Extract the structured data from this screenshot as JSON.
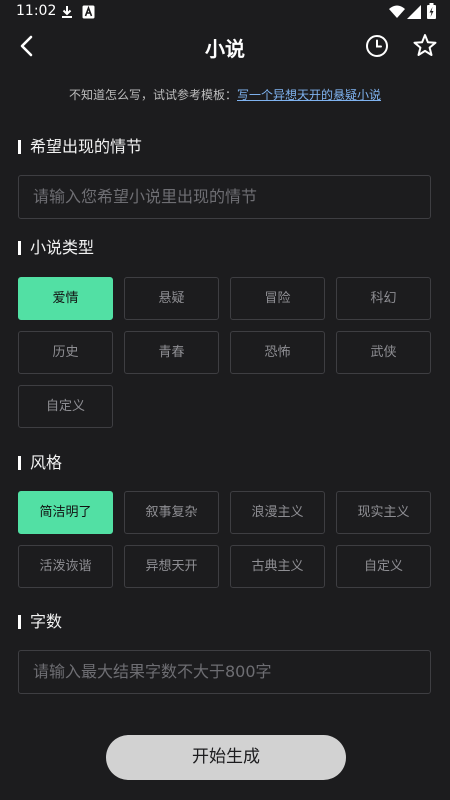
{
  "status_bar": {
    "time": "11:02"
  },
  "header": {
    "title": "小说"
  },
  "hint": {
    "prefix": "不知道怎么写，试试参考模板：",
    "link": "写一个异想天开的悬疑小说"
  },
  "plot": {
    "title": "希望出现的情节",
    "placeholder": "请输入您希望小说里出现的情节"
  },
  "genre": {
    "title": "小说类型",
    "options": [
      "爱情",
      "悬疑",
      "冒险",
      "科幻",
      "历史",
      "青春",
      "恐怖",
      "武侠",
      "自定义"
    ],
    "selected": "爱情"
  },
  "style": {
    "title": "风格",
    "options": [
      "简洁明了",
      "叙事复杂",
      "浪漫主义",
      "现实主义",
      "活泼诙谐",
      "异想天开",
      "古典主义",
      "自定义"
    ],
    "selected": "简洁明了"
  },
  "word_count": {
    "title": "字数",
    "placeholder": "请输入最大结果字数不大于800字"
  },
  "start_button": {
    "label": "开始生成"
  },
  "colors": {
    "background": "#1c1c1e",
    "accent": "#52e0a4",
    "link": "#7fb3f0",
    "button": "#d2d2d2"
  }
}
